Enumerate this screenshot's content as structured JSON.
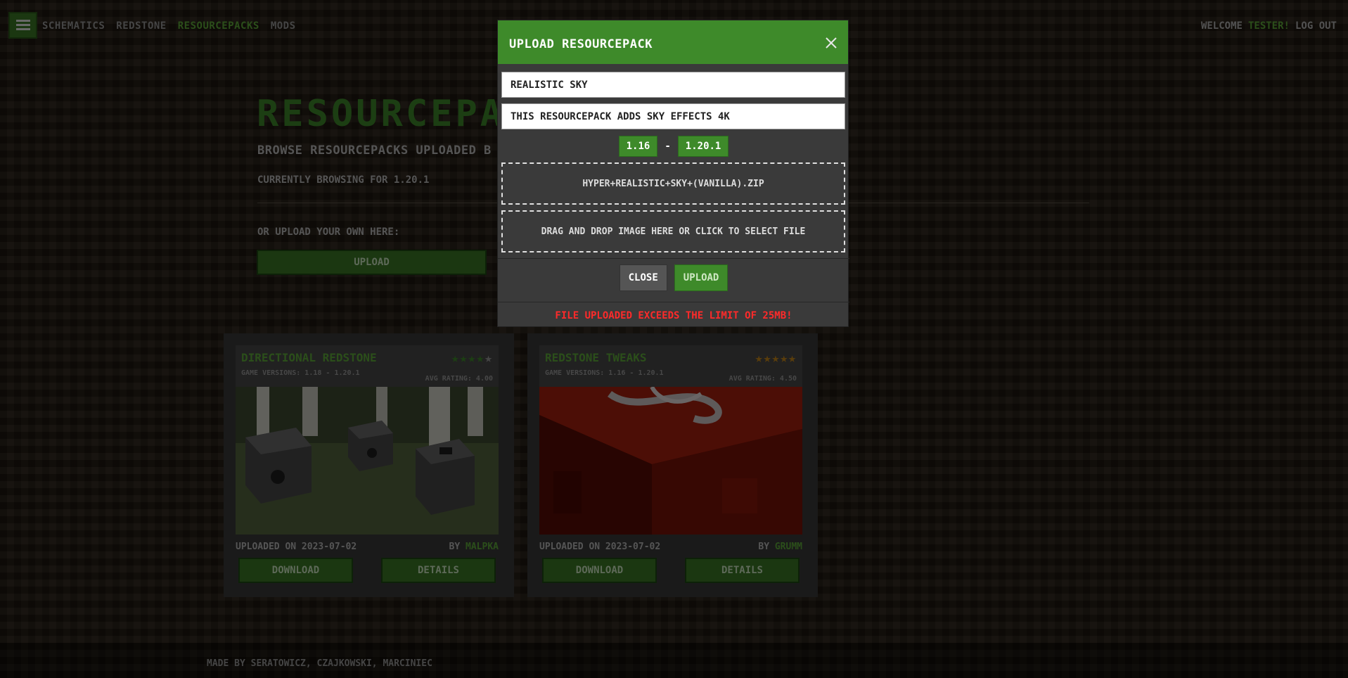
{
  "nav": {
    "items": [
      "Schematics",
      "Redstone",
      "Resourcepacks",
      "Mods"
    ],
    "active": "Resourcepacks"
  },
  "user": {
    "welcome": "Welcome",
    "name": "tester!",
    "logout": "Log out"
  },
  "hero": {
    "title": "Resourcepac",
    "subtitle": "Browse resourcepacks uploaded b",
    "browsing": "Currently browsing for 1.20.1",
    "upload_label": "Or upload your own here:",
    "upload_button": "Upload"
  },
  "cards": [
    {
      "title": "Directional Redstone",
      "versions": "Game versions: 1.18 - 1.20.1",
      "stars": 4,
      "avg_rating": "Avg rating: 4.00",
      "uploaded": "Uploaded on 2023-07-02",
      "by": "by",
      "author": "Malpka",
      "download": "Download",
      "details": "Details"
    },
    {
      "title": "Redstone Tweaks",
      "versions": "Game versions: 1.16 - 1.20.1",
      "stars": 5,
      "avg_rating": "Avg rating: 4.50",
      "uploaded": "Uploaded on 2023-07-02",
      "by": "by",
      "author": "Grumm",
      "download": "Download",
      "details": "Details"
    }
  ],
  "footer": {
    "credits": "Made by Seratowicz, Czajkowski, Marciniec"
  },
  "modal": {
    "title": "Upload Resourcepack",
    "name_value": "Realistic Sky",
    "description_value": "This resourcepack adds sky effects 4K",
    "version_from": "1.16",
    "version_sep": "-",
    "version_to": "1.20.1",
    "file_name": "Hyper+Realistic+Sky+(Vanilla).zip",
    "image_drop": "Drag and drop image here or click to select file",
    "close_button": "Close",
    "upload_button": "Upload",
    "error": "File uploaded exceeds the limit of 25MB!"
  },
  "colors": {
    "accent_green": "#3e8a2a",
    "error_red": "#ff2a2a",
    "star_gold": "#c8881a"
  }
}
